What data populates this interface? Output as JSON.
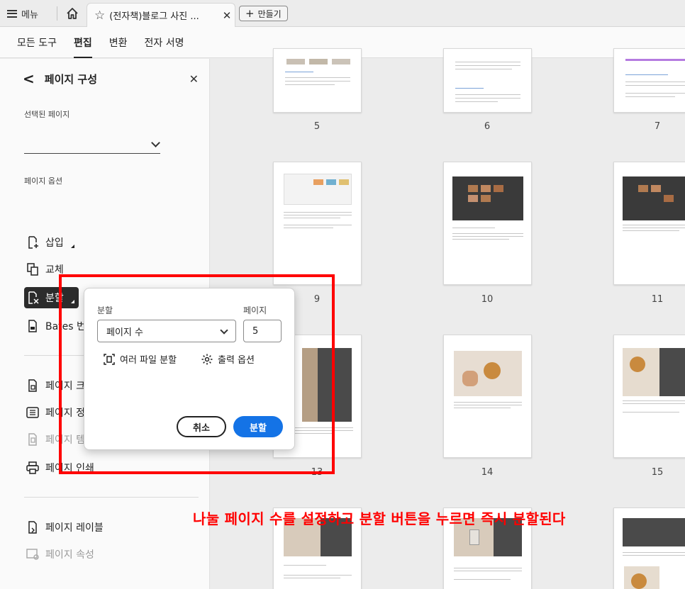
{
  "topbar": {
    "menu_label": "메뉴",
    "tab_title": "(전자책)블로그 사진 ...",
    "create_label": "만들기"
  },
  "tool_tabs": [
    {
      "label": "모든 도구"
    },
    {
      "label": "편집"
    },
    {
      "label": "변환"
    },
    {
      "label": "전자 서명"
    }
  ],
  "panel": {
    "title": "페이지 구성",
    "selected_pages_label": "선택된 페이지",
    "page_options_label": "페이지 옵션",
    "items": {
      "insert": "삽입",
      "replace": "교체",
      "split": "분할",
      "bates": "Bates 번...",
      "page_size": "페이지 크",
      "page_layout": "페이지 정",
      "page_template": "페이지 템",
      "page_print": "페이지 인쇄",
      "page_label": "페이지 레이블",
      "page_props": "페이지 속성"
    }
  },
  "popup": {
    "split_label": "분할",
    "pages_label": "페이지",
    "split_mode": "페이지 수",
    "page_count": "5",
    "multi_file_label": "여러 파일 분할",
    "output_options_label": "출력 옵션",
    "cancel_label": "취소",
    "split_button_label": "분할"
  },
  "pages": {
    "p5": "5",
    "p6": "6",
    "p7": "7",
    "p9": "9",
    "p10": "10",
    "p11": "11",
    "p13": "13",
    "p14": "14",
    "p15": "15"
  },
  "annotation": {
    "caption": "나눌 페이지 수를 설정하고 분할 버튼을 누르면 즉시 분할된다",
    "color": "#ff0000"
  },
  "colors": {
    "accent": "#1473e6",
    "active_item": "#2c2c2c"
  }
}
